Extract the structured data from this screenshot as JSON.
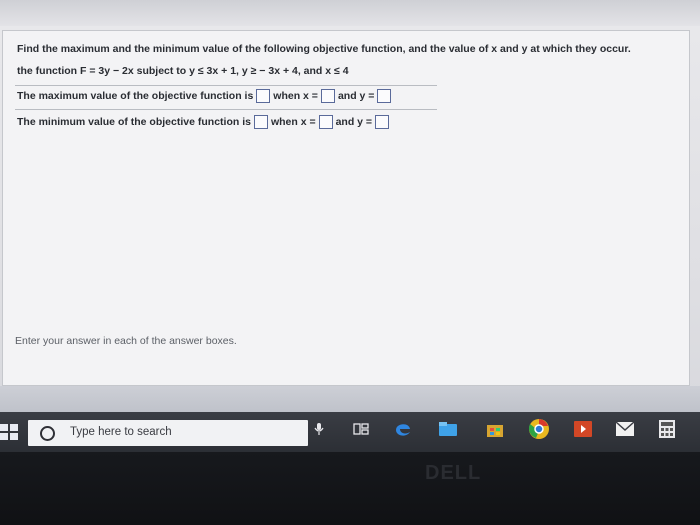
{
  "question": {
    "line1": "Find the maximum and the minimum value of the following objective function, and the value of x and y at which they occur.",
    "line2": "the function F = 3y − 2x subject to y ≤ 3x + 1, y ≥ − 3x + 4, and x ≤ 4",
    "max_line": {
      "prefix": "The maximum value of the objective function is",
      "when_x": "when x =",
      "and_y": "and y ="
    },
    "min_line": {
      "prefix": "The minimum value of the objective function is",
      "when_x": "when x =",
      "and_y": "and y ="
    }
  },
  "hint": "Enter your answer in each of the answer boxes.",
  "taskbar": {
    "search_placeholder": "Type here to search"
  },
  "brand": "DELL",
  "colors": {
    "edge": "#1e6fd0",
    "store": "#2b8ad6",
    "chrome": "#e0b020",
    "ppt": "#d24726",
    "mail": "#1a73c9"
  }
}
